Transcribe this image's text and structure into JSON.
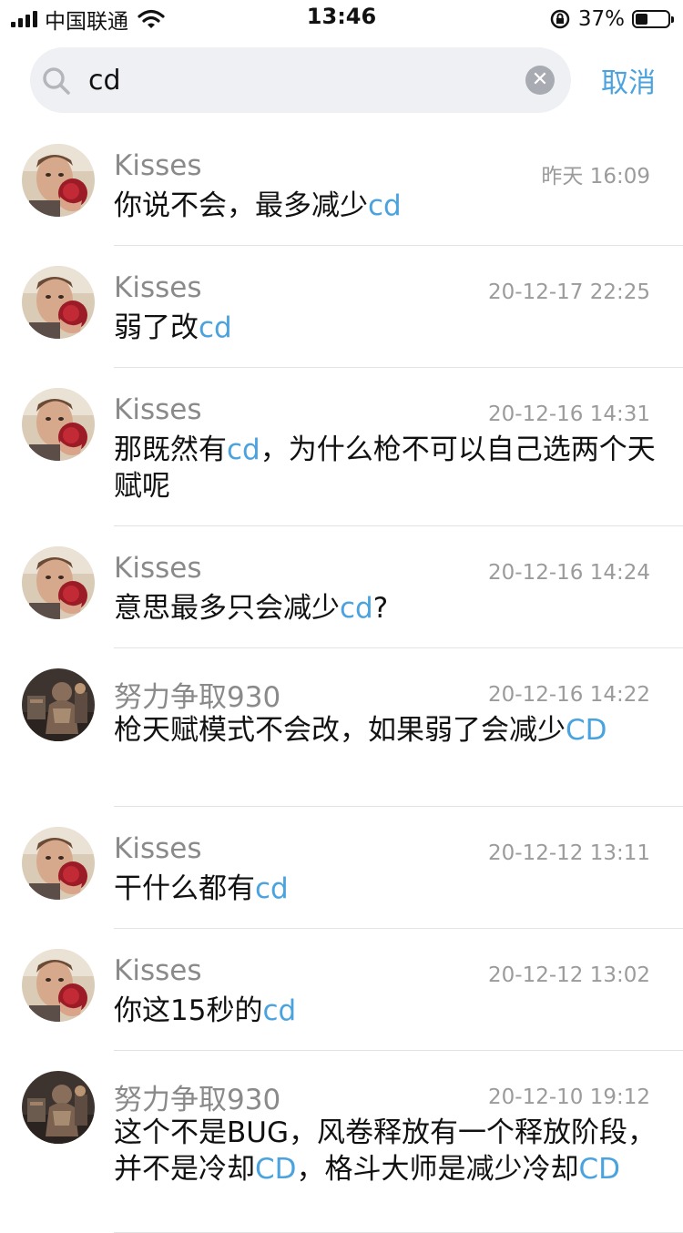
{
  "status_bar": {
    "carrier": "中国联通",
    "time": "13:46",
    "battery": "37%",
    "battery_level": 0.37
  },
  "search": {
    "query": "cd",
    "cancel_label": "取消"
  },
  "results": [
    {
      "name": "Kisses",
      "time": "昨天 16:09",
      "avatar": "man-with-rose-avatar",
      "segments": [
        {
          "t": "你说不会，最多减少"
        },
        {
          "t": "cd",
          "hl": true
        }
      ]
    },
    {
      "name": "Kisses",
      "time": "20-12-17 22:25",
      "avatar": "man-with-rose-avatar",
      "segments": [
        {
          "t": "弱了改"
        },
        {
          "t": "cd",
          "hl": true
        }
      ]
    },
    {
      "name": "Kisses",
      "time": "20-12-16 14:31",
      "avatar": "man-with-rose-avatar",
      "segments": [
        {
          "t": "那既然有"
        },
        {
          "t": "cd",
          "hl": true
        },
        {
          "t": "，为什么枪不可以自己选两个天赋呢"
        }
      ]
    },
    {
      "name": "Kisses",
      "time": "20-12-16 14:24",
      "avatar": "man-with-rose-avatar",
      "segments": [
        {
          "t": "意思最多只会减少"
        },
        {
          "t": "cd",
          "hl": true
        },
        {
          "t": "?"
        }
      ]
    },
    {
      "name": "努力争取930",
      "time": "20-12-16 14:22",
      "avatar": "game-character-avatar",
      "segments": [
        {
          "t": "枪天赋模式不会改，如果弱了会减少"
        },
        {
          "t": "CD",
          "hl": true
        }
      ]
    },
    {
      "name": "Kisses",
      "time": "20-12-12 13:11",
      "avatar": "man-with-rose-avatar",
      "segments": [
        {
          "t": "干什么都有"
        },
        {
          "t": "cd",
          "hl": true
        }
      ]
    },
    {
      "name": "Kisses",
      "time": "20-12-12 13:02",
      "avatar": "man-with-rose-avatar",
      "segments": [
        {
          "t": "你这15秒的"
        },
        {
          "t": "cd",
          "hl": true
        }
      ]
    },
    {
      "name": "努力争取930",
      "time": "20-12-10 19:12",
      "avatar": "game-character-avatar",
      "segments": [
        {
          "t": "这个不是BUG，风卷释放有一个释放阶段，并不是冷却"
        },
        {
          "t": "CD",
          "hl": true
        },
        {
          "t": "，格斗大师是减少冷却"
        },
        {
          "t": "CD",
          "hl": true
        }
      ]
    }
  ]
}
